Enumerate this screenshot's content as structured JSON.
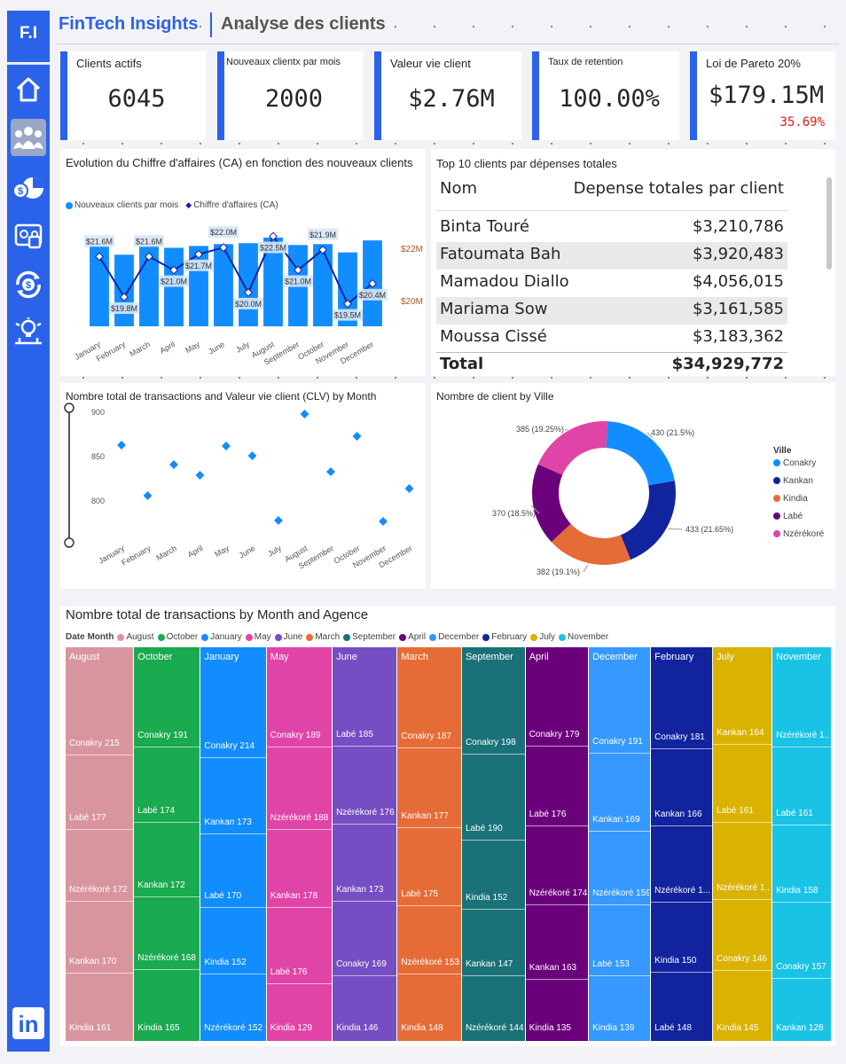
{
  "header": {
    "logo": "F.I",
    "brand": "FinTech Insights",
    "page_title": "Analyse des clients"
  },
  "kpis": [
    {
      "label": "Clients actifs",
      "value": "6045"
    },
    {
      "label": "Nouveaux clientx par mois",
      "value": "2000"
    },
    {
      "label": "Valeur vie client",
      "value": "$2.76M"
    },
    {
      "label": "Taux de retention",
      "value": "100.00%"
    },
    {
      "label": "Loi de Pareto 20%",
      "value": "$179.15M",
      "sub": "35.69%"
    }
  ],
  "nav_icons": [
    "home-icon",
    "clients-icon",
    "finance-chart-icon",
    "security-icon",
    "transfer-icon",
    "insights-icon"
  ],
  "colors": {
    "accent": "#2a62ea",
    "bar": "#118dff",
    "line": "#12239e",
    "pareto_sub": "#e0171e"
  },
  "combo": {
    "title": "Evolution du Chiffre d'affaires (CA) en fonction des nouveaux clients",
    "legend_bar": "Nouveaux clients par mois",
    "legend_line": "Chiffre d'affaires (CA)",
    "right_ticks": [
      "$22M",
      "$20M"
    ]
  },
  "top10": {
    "title": "Top 10 clients par dépenses totales",
    "col_name": "Nom",
    "col_value": "Depense totales par client",
    "rows": [
      {
        "name": "Binta Touré",
        "value": "$3,210,786"
      },
      {
        "name": "Fatoumata Bah",
        "value": "$3,920,483"
      },
      {
        "name": "Mamadou Diallo",
        "value": "$4,056,015"
      },
      {
        "name": "Mariama Sow",
        "value": "$3,161,585"
      },
      {
        "name": "Moussa Cissé",
        "value": "$3,183,362"
      }
    ],
    "total_label": "Total",
    "total_value": "$34,929,772"
  },
  "scatter": {
    "title": "Nombre total de transactions and Valeur vie client (CLV) by Month"
  },
  "donut": {
    "title": "Nombre de client by Ville",
    "legend_title": "Ville"
  },
  "treemap": {
    "title": "Nombre total de transactions by Month and Agence",
    "legend_title": "Date Month",
    "columns": [
      {
        "month": "August",
        "color": "#d9959e",
        "cells": [
          {
            "l": "Conakry 215",
            "v": 215
          },
          {
            "l": "Labé 177",
            "v": 177
          },
          {
            "l": "Nzérékoré 172",
            "v": 172
          },
          {
            "l": "Kankan 170",
            "v": 170
          },
          {
            "l": "Kindia 161",
            "v": 161
          }
        ]
      },
      {
        "month": "October",
        "color": "#1aaa50",
        "cells": [
          {
            "l": "Conakry 191",
            "v": 191
          },
          {
            "l": "Labé 174",
            "v": 174
          },
          {
            "l": "Kankan 172",
            "v": 172
          },
          {
            "l": "Nzérékoré 168",
            "v": 168
          },
          {
            "l": "Kindia 165",
            "v": 165
          }
        ]
      },
      {
        "month": "January",
        "color": "#118dff",
        "cells": [
          {
            "l": "Conakry 214",
            "v": 214
          },
          {
            "l": "Kankan 173",
            "v": 173
          },
          {
            "l": "Labé 170",
            "v": 170
          },
          {
            "l": "Kindia 152",
            "v": 152
          },
          {
            "l": "Nzérékoré 152",
            "v": 152
          }
        ]
      },
      {
        "month": "May",
        "color": "#e044a7",
        "cells": [
          {
            "l": "Conakry 189",
            "v": 189
          },
          {
            "l": "Nzérékoré 188",
            "v": 188
          },
          {
            "l": "Kankan 178",
            "v": 178
          },
          {
            "l": "Labé 176",
            "v": 176
          },
          {
            "l": "Kindia 129",
            "v": 129
          }
        ]
      },
      {
        "month": "June",
        "color": "#744ec2",
        "cells": [
          {
            "l": "Labé 185",
            "v": 185
          },
          {
            "l": "Nzérékoré 176",
            "v": 176
          },
          {
            "l": "Kankan 173",
            "v": 173
          },
          {
            "l": "Conakry 169",
            "v": 169
          },
          {
            "l": "Kindia 146",
            "v": 146
          }
        ]
      },
      {
        "month": "March",
        "color": "#e66c37",
        "cells": [
          {
            "l": "Conakry 187",
            "v": 187
          },
          {
            "l": "Kankan 177",
            "v": 177
          },
          {
            "l": "Labé 175",
            "v": 175
          },
          {
            "l": "Nzérékoré 153",
            "v": 153
          },
          {
            "l": "Kindia 148",
            "v": 148
          }
        ]
      },
      {
        "month": "September",
        "color": "#197278",
        "cells": [
          {
            "l": "Conakry 198",
            "v": 198
          },
          {
            "l": "Labé 190",
            "v": 190
          },
          {
            "l": "Kindia 152",
            "v": 152
          },
          {
            "l": "Kankan 147",
            "v": 147
          },
          {
            "l": "Nzérékoré 144",
            "v": 144
          }
        ]
      },
      {
        "month": "April",
        "color": "#6b007b",
        "cells": [
          {
            "l": "Conakry 179",
            "v": 179
          },
          {
            "l": "Labé 176",
            "v": 176
          },
          {
            "l": "Nzérékoré 174",
            "v": 174
          },
          {
            "l": "Kankan 163",
            "v": 163
          },
          {
            "l": "Kindia 135",
            "v": 135
          }
        ]
      },
      {
        "month": "December",
        "color": "#3599ff",
        "cells": [
          {
            "l": "Conakry 191",
            "v": 191
          },
          {
            "l": "Kankan 169",
            "v": 169
          },
          {
            "l": "Nzérékoré 159",
            "v": 159
          },
          {
            "l": "Labé 153",
            "v": 153
          },
          {
            "l": "Kindia 139",
            "v": 139
          }
        ]
      },
      {
        "month": "February",
        "color": "#12239e",
        "cells": [
          {
            "l": "Conakry 181",
            "v": 181
          },
          {
            "l": "Kankan 166",
            "v": 166
          },
          {
            "l": "Nzérékoré 1...",
            "v": 165
          },
          {
            "l": "Kindia 150",
            "v": 150
          },
          {
            "l": "Labé 148",
            "v": 148
          }
        ]
      },
      {
        "month": "July",
        "color": "#d9b300",
        "cells": [
          {
            "l": "Kankan 164",
            "v": 164
          },
          {
            "l": "Labé 161",
            "v": 161
          },
          {
            "l": "Nzérékoré 1...",
            "v": 160
          },
          {
            "l": "Conakry 146",
            "v": 146
          },
          {
            "l": "Kindia 145",
            "v": 145
          }
        ]
      },
      {
        "month": "November",
        "color": "#19c3e6",
        "cells": [
          {
            "l": "Nzérékoré 1...",
            "v": 170
          },
          {
            "l": "Labé 161",
            "v": 161
          },
          {
            "l": "Kindia 158",
            "v": 158
          },
          {
            "l": "Conakry 157",
            "v": 157
          },
          {
            "l": "Kankan 128",
            "v": 128
          }
        ]
      }
    ]
  },
  "chart_data": [
    {
      "type": "bar",
      "title": "Evolution du Chiffre d'affaires (CA) en fonction des nouveaux clients",
      "categories": [
        "January",
        "February",
        "March",
        "April",
        "May",
        "June",
        "July",
        "August",
        "September",
        "October",
        "November",
        "December"
      ],
      "series": [
        {
          "name": "Nouveaux clients par mois",
          "type": "bar",
          "values": [
            175,
            155,
            174,
            170,
            174,
            178,
            180,
            192,
            176,
            178,
            160,
            186
          ]
        },
        {
          "name": "Chiffre d'affaires (CA)",
          "type": "line",
          "values": [
            21.6,
            19.8,
            21.6,
            21.0,
            21.7,
            22.0,
            20.0,
            22.5,
            21.0,
            21.9,
            19.5,
            20.4
          ]
        }
      ],
      "data_labels": [
        "$21.6M",
        "$19.8M",
        "$21.6M",
        "$21.0M",
        "$21.7M",
        "$22.0M",
        "$20.0M",
        "$22.5M",
        "$21.0M",
        "$21.9M",
        "$19.5M",
        "$20.4M"
      ],
      "ylim_line": [
        18.5,
        22.6
      ]
    },
    {
      "type": "scatter",
      "title": "Nombre total de transactions and Valeur vie client (CLV) by Month",
      "categories": [
        "January",
        "February",
        "March",
        "April",
        "May",
        "June",
        "July",
        "August",
        "September",
        "October",
        "November",
        "December"
      ],
      "values": [
        862,
        805,
        840,
        828,
        861,
        850,
        777,
        897,
        832,
        872,
        776,
        813
      ],
      "yticks": [
        900,
        850,
        800
      ],
      "ylim": [
        760,
        910
      ]
    },
    {
      "type": "pie",
      "title": "Nombre de client by Ville",
      "legend_title": "Ville",
      "labels": [
        "Conakry",
        "Kankan",
        "Kindia",
        "Labé",
        "Nzérékoré"
      ],
      "values": [
        430,
        433,
        382,
        370,
        385
      ],
      "data_labels": [
        "430 (21.5%)",
        "433 (21.65%)",
        "382 (19.1%)",
        "370 (18.5%)",
        "385 (19.25%)"
      ],
      "colors": [
        "#118dff",
        "#12239e",
        "#e66c37",
        "#6b007b",
        "#e044a7"
      ]
    }
  ]
}
